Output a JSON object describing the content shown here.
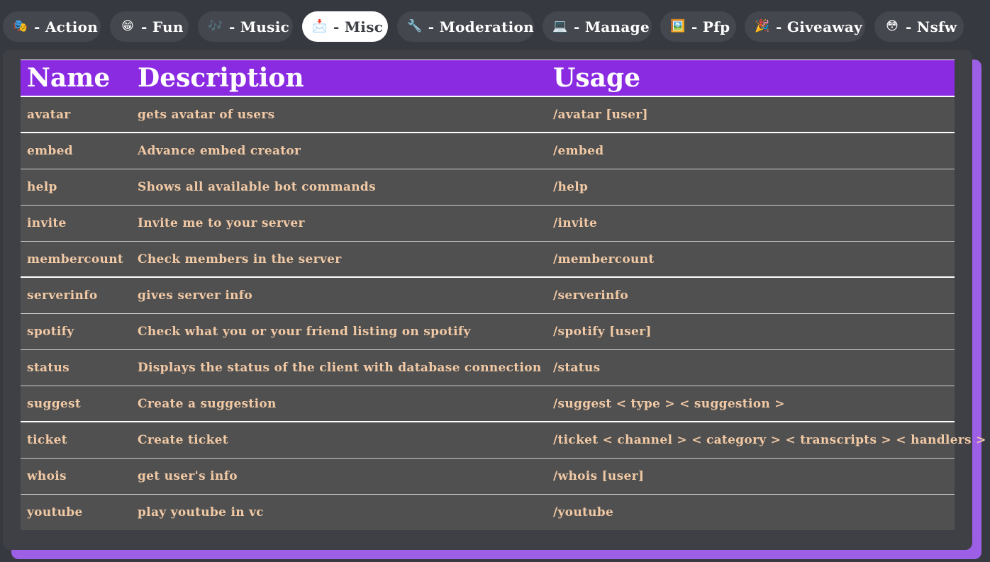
{
  "tabs": [
    {
      "emoji": "🎭",
      "label": "- Action",
      "active": false
    },
    {
      "emoji": "😁",
      "label": "- Fun",
      "active": false
    },
    {
      "emoji": "🎶",
      "label": "- Music",
      "active": false
    },
    {
      "emoji": "📩",
      "label": "- Misc",
      "active": true
    },
    {
      "emoji": "🔧",
      "label": "- Moderation",
      "active": false
    },
    {
      "emoji": "💻",
      "label": "- Manage",
      "active": false
    },
    {
      "emoji": "🖼️",
      "label": "- Pfp",
      "active": false
    },
    {
      "emoji": "🎉",
      "label": "- Giveaway",
      "active": false
    },
    {
      "emoji": "😳",
      "label": "- Nsfw",
      "active": false
    }
  ],
  "table": {
    "headers": {
      "name": "Name",
      "description": "Description",
      "usage": "Usage"
    },
    "rows": [
      {
        "name": "avatar",
        "description": "gets avatar of users",
        "usage": "/avatar [user]"
      },
      {
        "name": "embed",
        "description": "Advance embed creator",
        "usage": "/embed"
      },
      {
        "name": "help",
        "description": "Shows all available bot commands",
        "usage": "/help"
      },
      {
        "name": "invite",
        "description": "Invite me to your server",
        "usage": "/invite"
      },
      {
        "name": "membercount",
        "description": "Check members in the server",
        "usage": "/membercount"
      },
      {
        "name": "serverinfo",
        "description": "gives server info",
        "usage": "/serverinfo"
      },
      {
        "name": "spotify",
        "description": "Check what you or your friend listing on spotify",
        "usage": "/spotify [user]"
      },
      {
        "name": "status",
        "description": "Displays the status of the client with database connection",
        "usage": "/status"
      },
      {
        "name": "suggest",
        "description": "Create a suggestion",
        "usage": "/suggest < type > < suggestion >"
      },
      {
        "name": "ticket",
        "description": "Create ticket",
        "usage": "/ticket < channel > < category > < transcripts > < handlers >"
      },
      {
        "name": "whois",
        "description": "get user's info",
        "usage": "/whois [user]"
      },
      {
        "name": "youtube",
        "description": "play youtube in vc",
        "usage": "/youtube"
      }
    ]
  },
  "colors": {
    "background": "#36393f",
    "tab": "#44474d",
    "tab_active": "#ffffff",
    "header": "#8a2be2",
    "row": "#505050",
    "row_text": "#f1c9a5",
    "accent_shadow": "#9c5fe6"
  }
}
